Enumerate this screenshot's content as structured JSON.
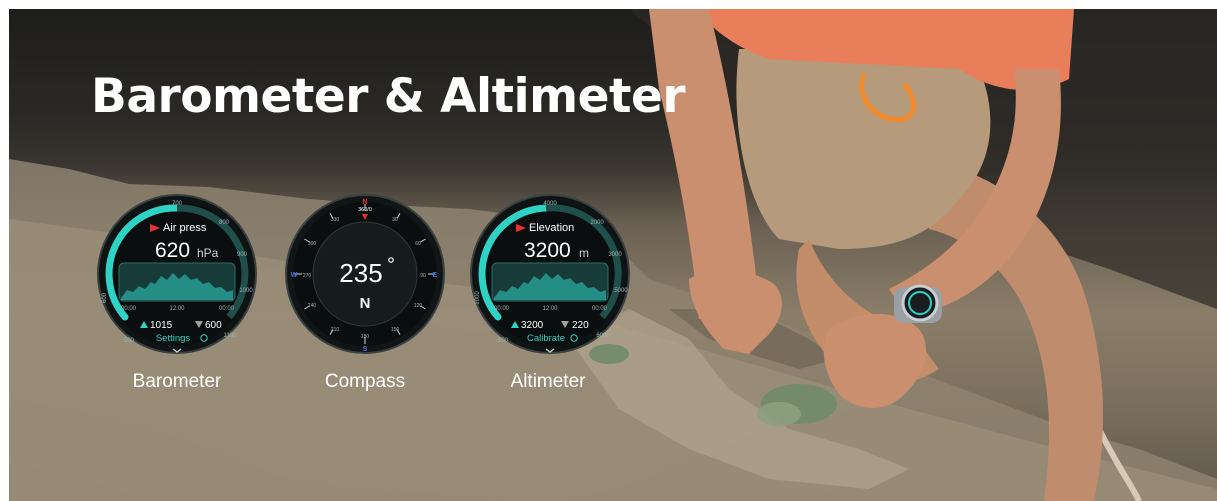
{
  "headline": "Barometer & Altimeter",
  "colors": {
    "accent": "#2fd3c6",
    "flag": "#e8322e",
    "shirt": "#e97f5a",
    "pants": "#b59a7c",
    "skin": "#c98f6e"
  },
  "watches": [
    {
      "id": "barometer",
      "label": "Barometer",
      "title": "Air press",
      "value": "620",
      "unit": "hPa",
      "ring_top": "700",
      "ring_left": "600",
      "ring_right": "1100",
      "ring_bottom_left": "500",
      "ring_bottom_right": "1100",
      "ring_small": [
        "800",
        "900",
        "1000"
      ],
      "time_start": "00:00",
      "time_mid": "12:00",
      "time_end": "00:00",
      "max_value": "1015",
      "min_value": "600",
      "action": "Settings",
      "gauge_level": 0.65
    },
    {
      "id": "compass",
      "label": "Compass",
      "heading": "235",
      "direction": "N",
      "top_mark": "360/0",
      "east": "E",
      "west": "W",
      "south": "S",
      "north": "N",
      "ticks": [
        "30",
        "60",
        "90",
        "120",
        "150",
        "180",
        "210",
        "240",
        "270",
        "300",
        "330"
      ]
    },
    {
      "id": "altimeter",
      "label": "Altimeter",
      "title": "Elevation",
      "value": "3200",
      "unit": "m",
      "ring_top": "4000",
      "ring_left": "1000",
      "ring_right": "5000",
      "ring_bottom_left": "-500",
      "ring_bottom_right": "6000",
      "ring_small": [
        "2000",
        "3000",
        "5000"
      ],
      "time_start": "00:00",
      "time_mid": "12:00",
      "time_end": "00:00",
      "max_value": "3200",
      "min_value": "220",
      "action": "Calibrate",
      "gauge_level": 0.6
    }
  ]
}
